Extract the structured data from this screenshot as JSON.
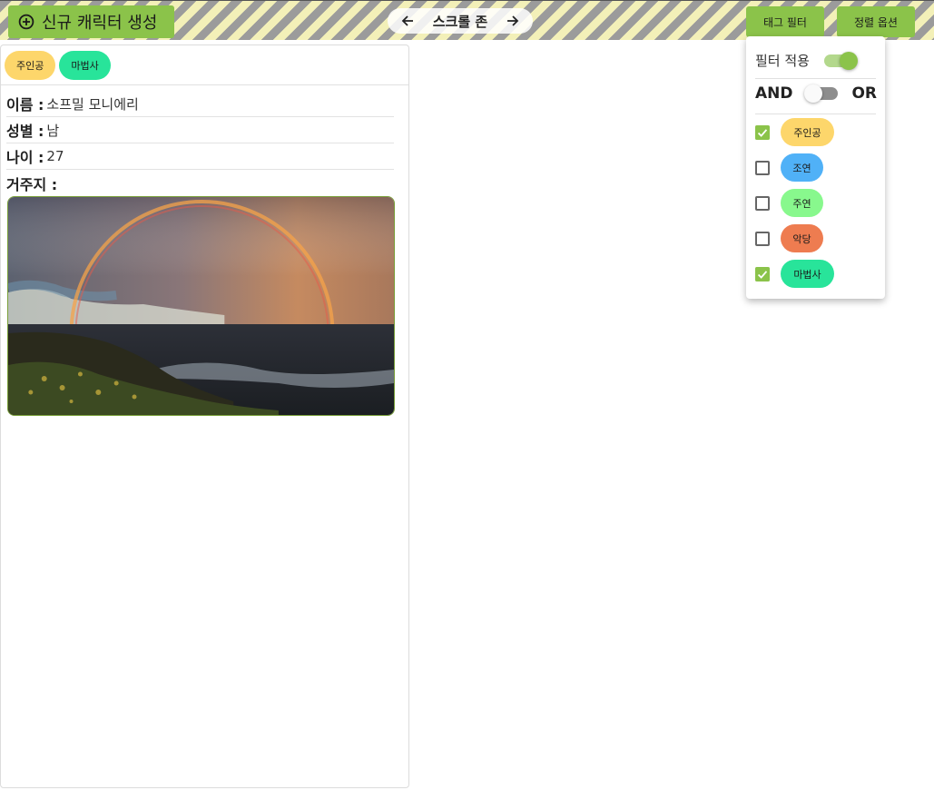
{
  "header": {
    "new_character_label": "신규 캐릭터 생성",
    "scroll_zone_label": "스크롤 존",
    "tag_filter_label": "태그 필터",
    "sort_options_label": "정렬 옵션"
  },
  "card": {
    "tags": [
      {
        "label": "주인공",
        "color": "#fdd66b"
      },
      {
        "label": "마법사",
        "color": "#28e49a"
      }
    ],
    "fields": [
      {
        "label": "이름 :",
        "value": "소프밀 모니에리"
      },
      {
        "label": "성별 :",
        "value": "남"
      },
      {
        "label": "나이 :",
        "value": "27"
      },
      {
        "label": "거주지 :",
        "value": ""
      }
    ],
    "image_icon": "rainbow-coast-photo"
  },
  "tag_filter_panel": {
    "apply_label": "필터 적용",
    "apply_on": true,
    "and_label": "AND",
    "or_label": "OR",
    "or_mode": false,
    "items": [
      {
        "label": "주인공",
        "checked": true,
        "color": "#fdd66b"
      },
      {
        "label": "조연",
        "checked": false,
        "color": "#50b1f7"
      },
      {
        "label": "주연",
        "checked": false,
        "color": "#88f88d"
      },
      {
        "label": "악당",
        "checked": false,
        "color": "#ee7c50"
      },
      {
        "label": "마법사",
        "checked": true,
        "color": "#28e49a"
      }
    ]
  },
  "colors": {
    "accent": "#8bc34a"
  }
}
